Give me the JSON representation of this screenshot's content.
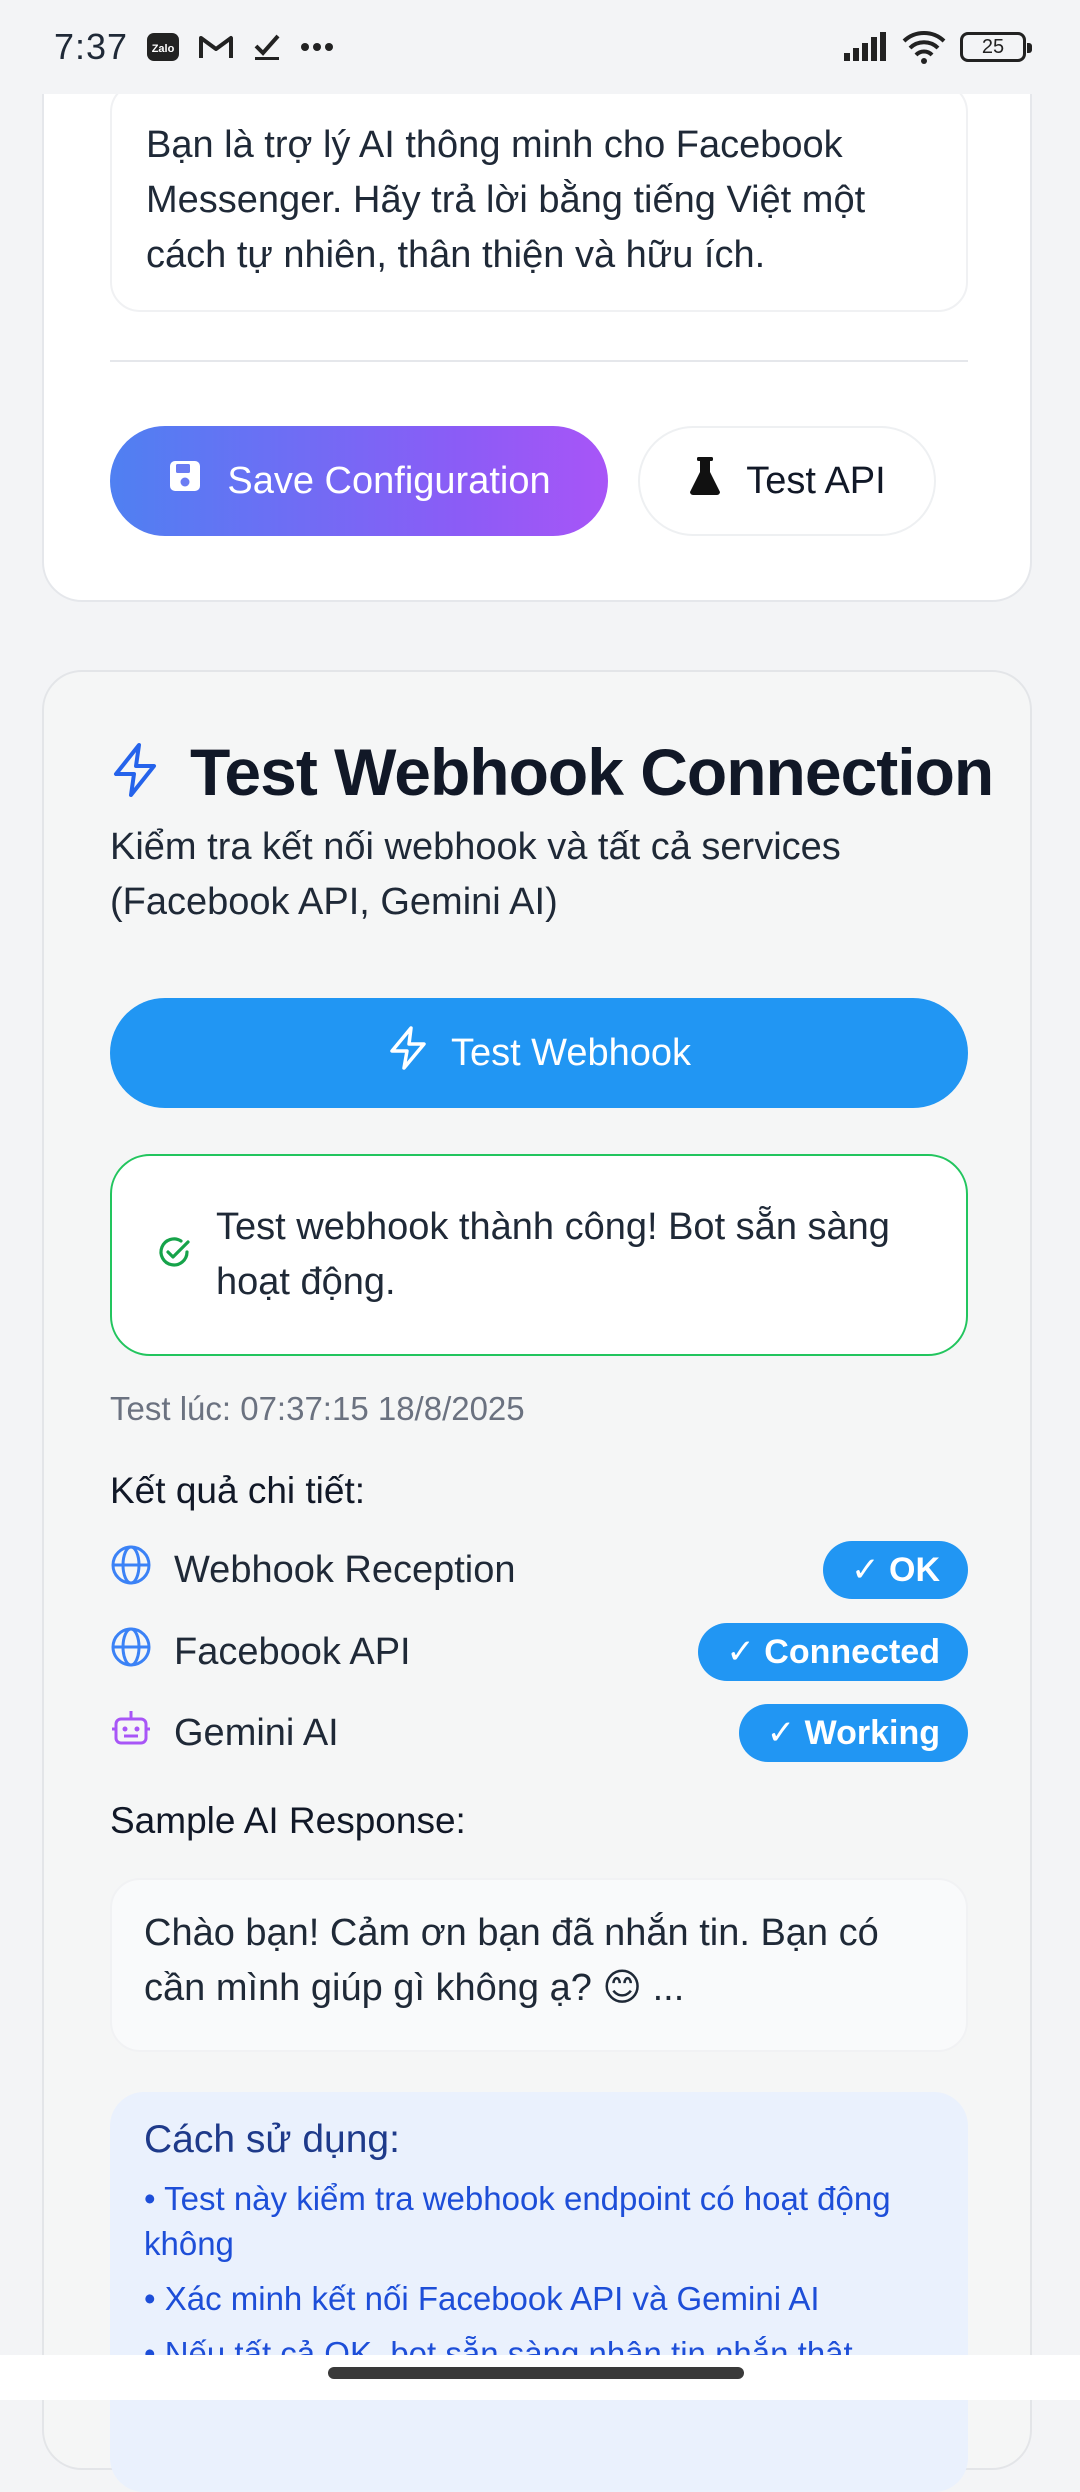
{
  "status_bar": {
    "time": "7:37",
    "notification_icons": [
      "zalo-icon",
      "gmail-icon",
      "check-icon",
      "more-icon"
    ],
    "battery": "25"
  },
  "config_card": {
    "system_prompt": "Bạn là trợ lý AI thông minh cho Facebook Messenger. Hãy trả lời bằng tiếng Việt một cách tự nhiên, thân thiện và hữu ích.",
    "save_label": "Save Configuration",
    "test_api_label": "Test API"
  },
  "webhook_card": {
    "title": "Test Webhook Connection",
    "subtitle": "Kiểm tra kết nối webhook và tất cả services (Facebook API, Gemini AI)",
    "button_label": "Test Webhook",
    "success_message": "Test webhook thành công! Bot sẵn sàng hoạt động.",
    "test_time": "Test lúc: 07:37:15 18/8/2025",
    "detail_label": "Kết quả chi tiết:",
    "results": [
      {
        "name": "Webhook Reception",
        "status": "✓ OK",
        "icon": "globe-icon"
      },
      {
        "name": "Facebook API",
        "status": "✓ Connected",
        "icon": "globe-icon"
      },
      {
        "name": "Gemini AI",
        "status": "✓ Working",
        "icon": "bot-icon"
      }
    ],
    "sample_label": "Sample AI Response:",
    "sample_response": "Chào bạn! Cảm ơn bạn đã nhắn tin. Bạn có cần mình giúp gì không ạ? 😊 ...",
    "usage": {
      "title": "Cách sử dụng:",
      "items": [
        "• Test này kiểm tra webhook endpoint có hoạt động không",
        "• Xác minh kết nối Facebook API và Gemini AI",
        "• Nếu tất cả OK, bot sẵn sàng nhận tin nhắn thật"
      ]
    }
  },
  "colors": {
    "accent_blue": "#2196f3",
    "success_green": "#22c55e",
    "gradient_start": "#4f80f2",
    "gradient_end": "#a855f7"
  }
}
